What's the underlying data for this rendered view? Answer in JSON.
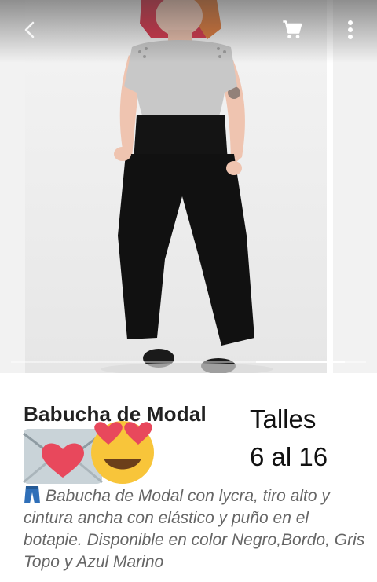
{
  "gallery": {
    "image_index": 1,
    "image_count": 4,
    "progress_fraction": 0.25
  },
  "toolbar": {
    "back_icon": "arrow-left-icon",
    "cart_icon": "shopping-cart-icon",
    "menu_icon": "more-vertical-icon",
    "icon_color": "#ffffff"
  },
  "product": {
    "title": "Babucha de Modal",
    "sizes_line1": "Talles",
    "sizes_line2": "6 al 16",
    "emojis": [
      "love-letter-icon",
      "heart-eyes-face-icon"
    ],
    "description_icon": "jeans-icon",
    "description": "Babucha de Modal con lycra, tiro alto y cintura ancha con elástico y puño en el botapie. Disponible en color Negro,Bordo, Gris Topo y Azul Marino"
  },
  "colors": {
    "title": "#222222",
    "description": "#666666",
    "accent_heart": "#e8485c",
    "emoji_yellow": "#f8c53a"
  }
}
